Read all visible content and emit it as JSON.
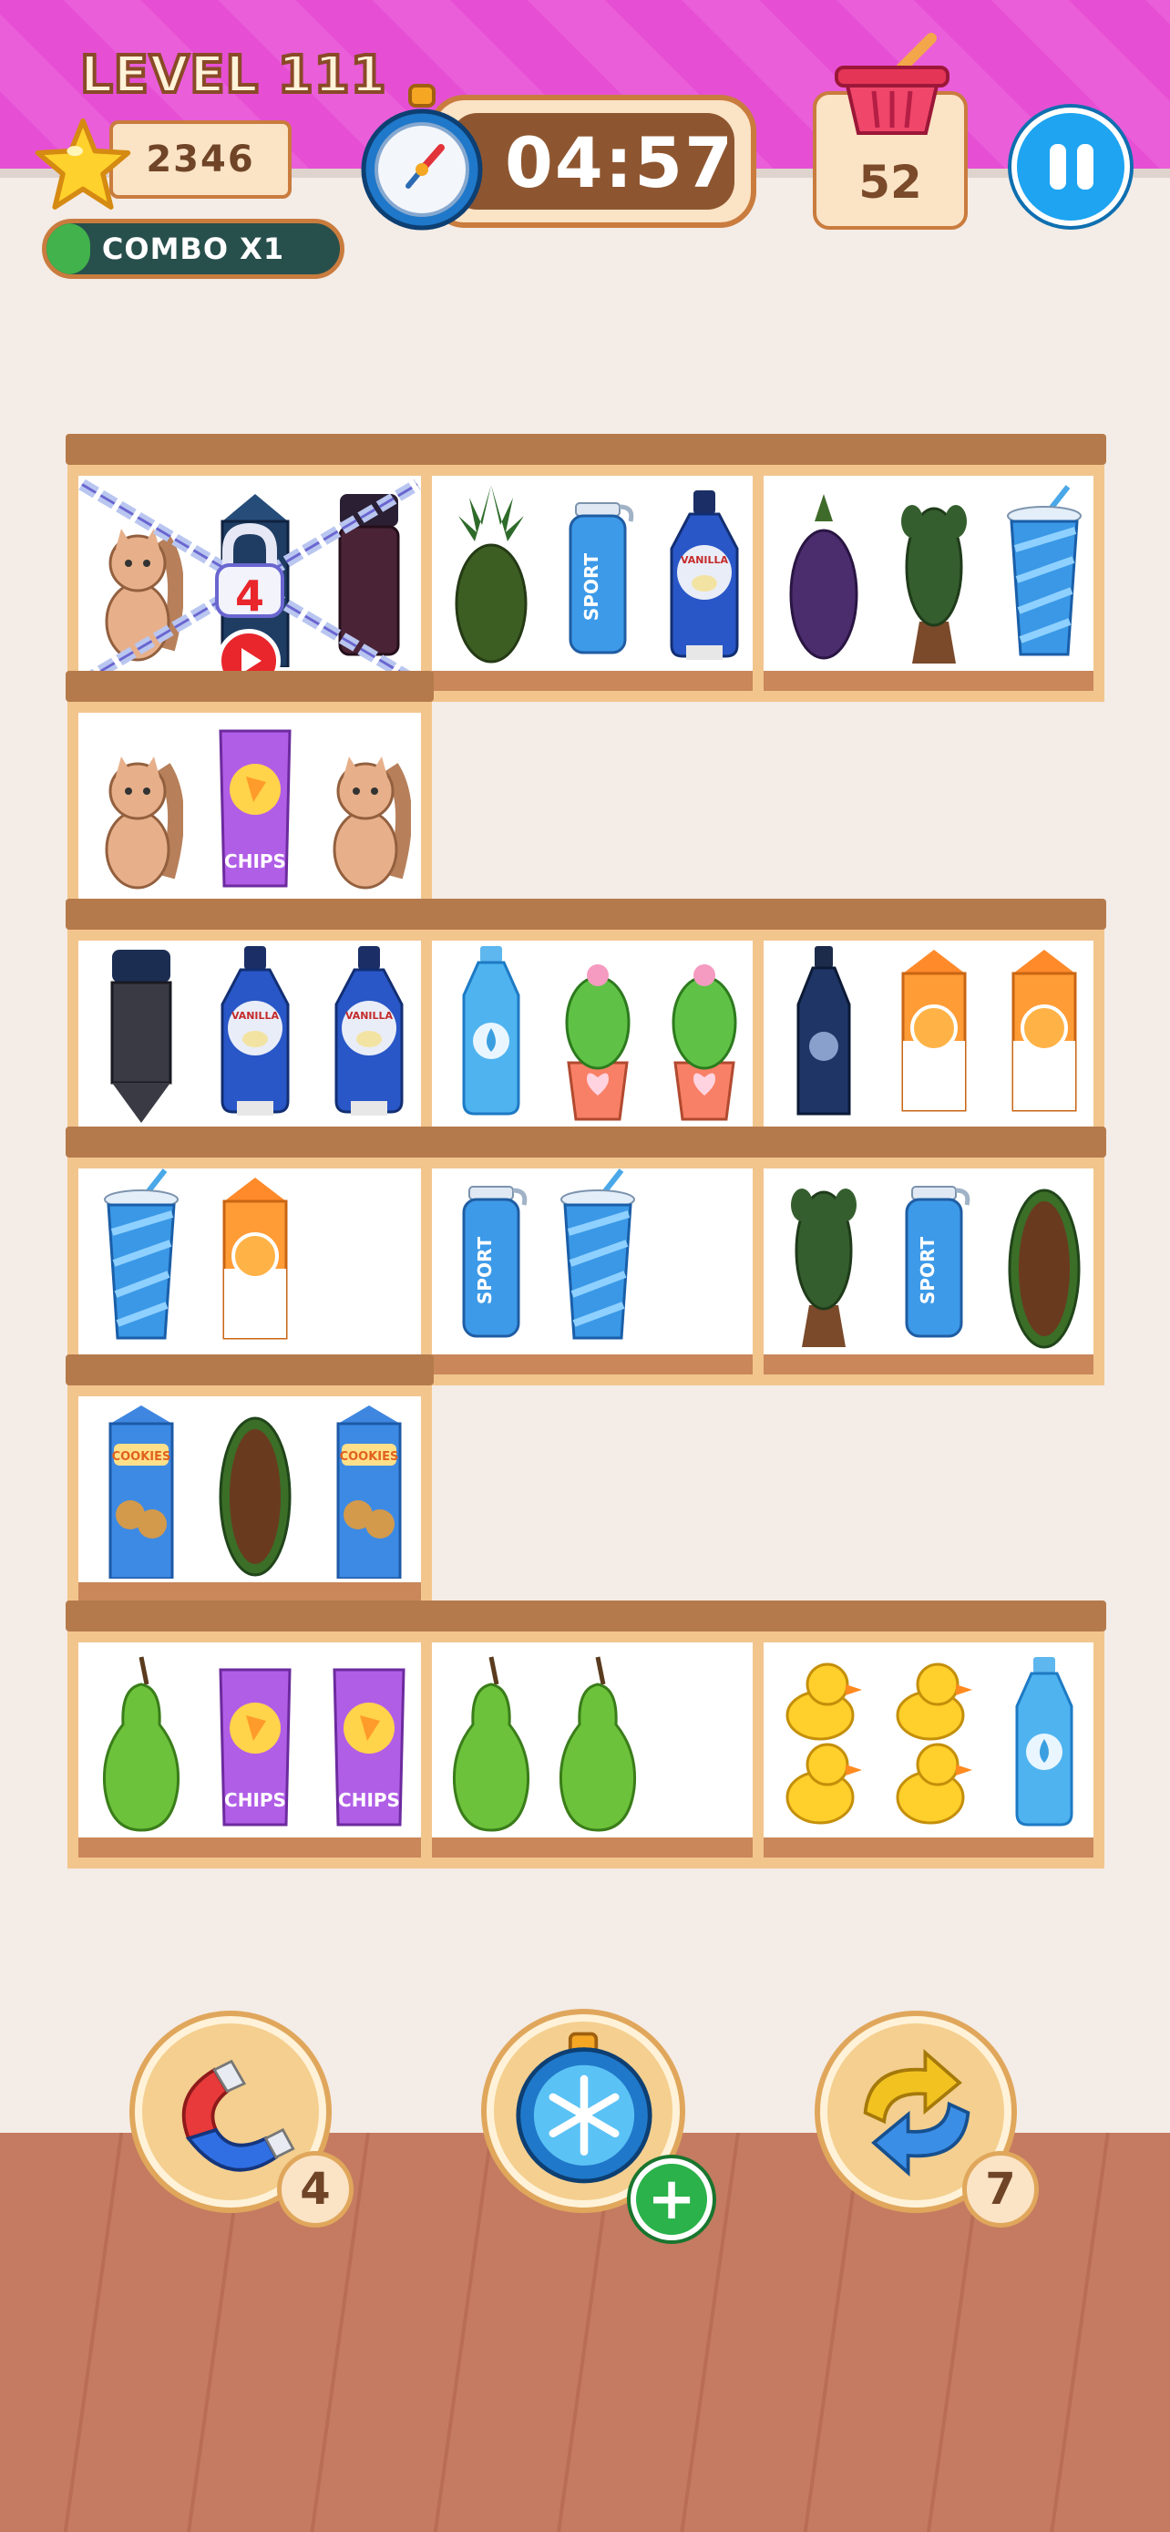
{
  "header": {
    "level_label": "LEVEL 111",
    "coins": "2346",
    "combo_label": "COMBO X1",
    "combo_progress": 0.15,
    "timer": "04:57",
    "basket_count": "52"
  },
  "colors": {
    "header_pink": "#e64fd4",
    "shelf_wood": "#f2c58d",
    "combo_green": "#41b24c",
    "pause_blue": "#1ea4f1"
  },
  "shelves": [
    {
      "row": 1,
      "cells": [
        {
          "locked": true,
          "unlock_count": "4",
          "items": [
            "cat-figurine",
            "milk-carton",
            "thermos"
          ]
        },
        {
          "items": [
            "pineapple",
            "sport-bottle",
            "vanilla-syrup"
          ]
        },
        {
          "items": [
            "eggplant",
            "cactus",
            "striped-cup"
          ]
        }
      ]
    },
    {
      "row": 2,
      "cells": [
        {
          "items": [
            "squirrel-figurine",
            "chips-bag",
            "squirrel-figurine"
          ]
        }
      ]
    },
    {
      "row": 3,
      "cells": [
        {
          "items": [
            "pencil-thermos",
            "vanilla-syrup",
            "vanilla-syrup"
          ]
        },
        {
          "items": [
            "water-bottle",
            "potted-cactus",
            "potted-cactus"
          ]
        },
        {
          "items": [
            "dark-bottle",
            "orange-juice-carton",
            "orange-juice-carton"
          ]
        }
      ]
    },
    {
      "row": 4,
      "cells": [
        {
          "items": [
            "striped-cup",
            "orange-juice-carton"
          ]
        },
        {
          "items": [
            "sport-bottle",
            "striped-cup"
          ]
        },
        {
          "items": [
            "heart-cactus",
            "sport-bottle",
            "papaya"
          ]
        }
      ]
    },
    {
      "row": 5,
      "cells": [
        {
          "items": [
            "cookies-carton",
            "papaya",
            "cookies-carton"
          ]
        }
      ]
    },
    {
      "row": 6,
      "cells": [
        {
          "items": [
            "pear",
            "chips-bag",
            "chips-bag"
          ]
        },
        {
          "items": [
            "pear",
            "pear"
          ]
        },
        {
          "items": [
            "rubber-ducks",
            "rubber-ducks",
            "water-bottle"
          ]
        }
      ]
    }
  ],
  "item_labels": {
    "sport": "SPORT",
    "vanilla": "VANILLA",
    "chips": "CHIPS",
    "cookies": "COOKIES"
  },
  "boosters": [
    {
      "name": "magnet",
      "count": "4"
    },
    {
      "name": "freeze",
      "count": ""
    },
    {
      "name": "shuffle",
      "count": "7"
    }
  ]
}
